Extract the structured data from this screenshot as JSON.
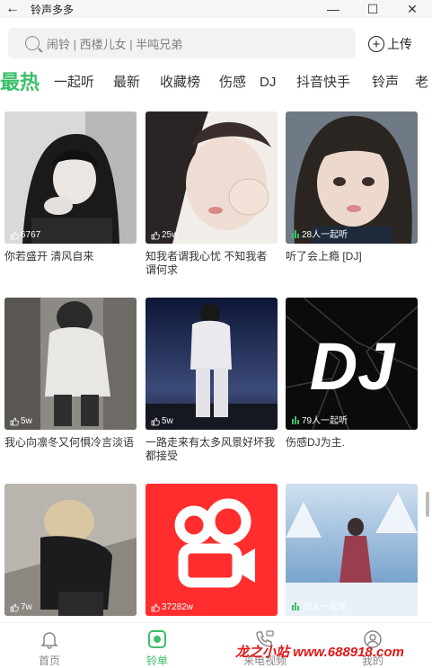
{
  "window": {
    "title": "铃声多多",
    "back_glyph": "←",
    "minimize_glyph": "—",
    "maximize_glyph": "☐",
    "close_glyph": "✕"
  },
  "search": {
    "placeholder": "闹铃 | 西楼儿女 | 半吨兄弟",
    "upload_label": "上传",
    "upload_glyph": "+"
  },
  "tabs": [
    {
      "label": "最热",
      "active": true
    },
    {
      "label": "一起听"
    },
    {
      "label": "最新"
    },
    {
      "label": "收藏榜"
    },
    {
      "label": "伤感"
    },
    {
      "label": "DJ"
    },
    {
      "label": "抖音快手"
    },
    {
      "label": "铃声"
    },
    {
      "label": "老"
    }
  ],
  "cards": [
    {
      "count": "6767",
      "count_icon": "thumb-up-icon",
      "title": "你若盛开 清风自来",
      "art": "girl-bw-hair"
    },
    {
      "count": "25w",
      "count_icon": "thumb-up-icon",
      "title": "知我者谓我心忧 不知我者谓何求",
      "art": "girl-fist"
    },
    {
      "count": "28人一起听",
      "count_icon": "listening-bars-icon",
      "title": "听了会上瘾 [DJ]",
      "art": "girl-closeup"
    },
    {
      "count": "5w",
      "count_icon": "thumb-up-icon",
      "title": "我心向凛冬又何惧冷言淡语",
      "art": "girl-hoodie"
    },
    {
      "count": "5w",
      "count_icon": "thumb-up-icon",
      "title": "一路走来有太多风景好坏我都接受",
      "art": "night-sky"
    },
    {
      "count": "79人一起听",
      "count_icon": "listening-bars-icon",
      "title": "伤感DJ为主.",
      "art": "dj-logo",
      "art_text": "DJ"
    },
    {
      "count": "7w",
      "count_icon": "thumb-up-icon",
      "title": "",
      "art": "boy-stairs"
    },
    {
      "count": "37282w",
      "count_icon": "thumb-up-icon",
      "title": "",
      "art": "kuaishou-logo"
    },
    {
      "count": "32人一起听",
      "count_icon": "listening-bars-icon",
      "title": "",
      "art": "snow-forest"
    }
  ],
  "nav": [
    {
      "label": "首页",
      "icon": "bell-icon"
    },
    {
      "label": "铃单",
      "icon": "music-list-icon",
      "active": true
    },
    {
      "label": "来电视频",
      "icon": "phone-video-icon"
    },
    {
      "label": "我的",
      "icon": "profile-icon"
    }
  ],
  "watermark": "龙之小站 www.688918.com",
  "colors": {
    "accent": "#3dbf6a",
    "kuaishou": "#ff2d2d",
    "watermark": "#e01818"
  }
}
